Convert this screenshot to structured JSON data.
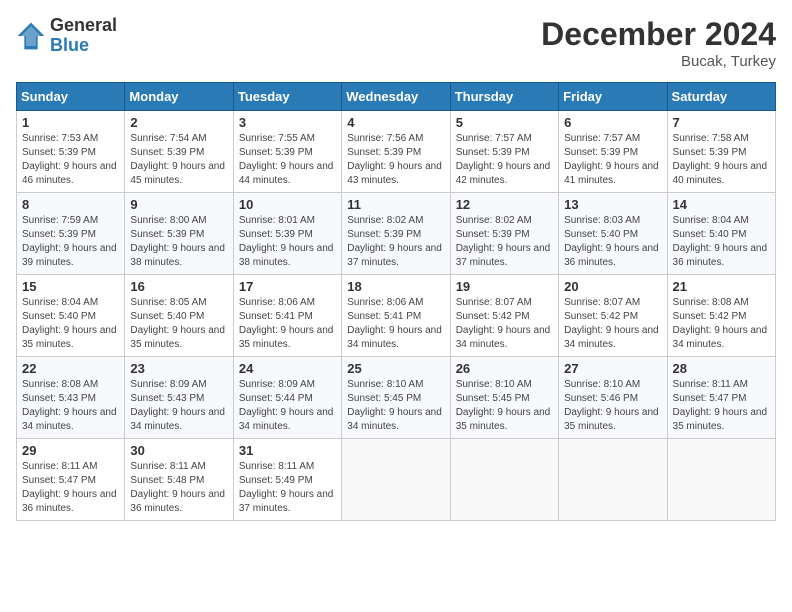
{
  "header": {
    "logo_general": "General",
    "logo_blue": "Blue",
    "month_year": "December 2024",
    "location": "Bucak, Turkey"
  },
  "columns": [
    "Sunday",
    "Monday",
    "Tuesday",
    "Wednesday",
    "Thursday",
    "Friday",
    "Saturday"
  ],
  "weeks": [
    [
      {
        "day": "1",
        "sunrise": "Sunrise: 7:53 AM",
        "sunset": "Sunset: 5:39 PM",
        "daylight": "Daylight: 9 hours and 46 minutes."
      },
      {
        "day": "2",
        "sunrise": "Sunrise: 7:54 AM",
        "sunset": "Sunset: 5:39 PM",
        "daylight": "Daylight: 9 hours and 45 minutes."
      },
      {
        "day": "3",
        "sunrise": "Sunrise: 7:55 AM",
        "sunset": "Sunset: 5:39 PM",
        "daylight": "Daylight: 9 hours and 44 minutes."
      },
      {
        "day": "4",
        "sunrise": "Sunrise: 7:56 AM",
        "sunset": "Sunset: 5:39 PM",
        "daylight": "Daylight: 9 hours and 43 minutes."
      },
      {
        "day": "5",
        "sunrise": "Sunrise: 7:57 AM",
        "sunset": "Sunset: 5:39 PM",
        "daylight": "Daylight: 9 hours and 42 minutes."
      },
      {
        "day": "6",
        "sunrise": "Sunrise: 7:57 AM",
        "sunset": "Sunset: 5:39 PM",
        "daylight": "Daylight: 9 hours and 41 minutes."
      },
      {
        "day": "7",
        "sunrise": "Sunrise: 7:58 AM",
        "sunset": "Sunset: 5:39 PM",
        "daylight": "Daylight: 9 hours and 40 minutes."
      }
    ],
    [
      {
        "day": "8",
        "sunrise": "Sunrise: 7:59 AM",
        "sunset": "Sunset: 5:39 PM",
        "daylight": "Daylight: 9 hours and 39 minutes."
      },
      {
        "day": "9",
        "sunrise": "Sunrise: 8:00 AM",
        "sunset": "Sunset: 5:39 PM",
        "daylight": "Daylight: 9 hours and 38 minutes."
      },
      {
        "day": "10",
        "sunrise": "Sunrise: 8:01 AM",
        "sunset": "Sunset: 5:39 PM",
        "daylight": "Daylight: 9 hours and 38 minutes."
      },
      {
        "day": "11",
        "sunrise": "Sunrise: 8:02 AM",
        "sunset": "Sunset: 5:39 PM",
        "daylight": "Daylight: 9 hours and 37 minutes."
      },
      {
        "day": "12",
        "sunrise": "Sunrise: 8:02 AM",
        "sunset": "Sunset: 5:39 PM",
        "daylight": "Daylight: 9 hours and 37 minutes."
      },
      {
        "day": "13",
        "sunrise": "Sunrise: 8:03 AM",
        "sunset": "Sunset: 5:40 PM",
        "daylight": "Daylight: 9 hours and 36 minutes."
      },
      {
        "day": "14",
        "sunrise": "Sunrise: 8:04 AM",
        "sunset": "Sunset: 5:40 PM",
        "daylight": "Daylight: 9 hours and 36 minutes."
      }
    ],
    [
      {
        "day": "15",
        "sunrise": "Sunrise: 8:04 AM",
        "sunset": "Sunset: 5:40 PM",
        "daylight": "Daylight: 9 hours and 35 minutes."
      },
      {
        "day": "16",
        "sunrise": "Sunrise: 8:05 AM",
        "sunset": "Sunset: 5:40 PM",
        "daylight": "Daylight: 9 hours and 35 minutes."
      },
      {
        "day": "17",
        "sunrise": "Sunrise: 8:06 AM",
        "sunset": "Sunset: 5:41 PM",
        "daylight": "Daylight: 9 hours and 35 minutes."
      },
      {
        "day": "18",
        "sunrise": "Sunrise: 8:06 AM",
        "sunset": "Sunset: 5:41 PM",
        "daylight": "Daylight: 9 hours and 34 minutes."
      },
      {
        "day": "19",
        "sunrise": "Sunrise: 8:07 AM",
        "sunset": "Sunset: 5:42 PM",
        "daylight": "Daylight: 9 hours and 34 minutes."
      },
      {
        "day": "20",
        "sunrise": "Sunrise: 8:07 AM",
        "sunset": "Sunset: 5:42 PM",
        "daylight": "Daylight: 9 hours and 34 minutes."
      },
      {
        "day": "21",
        "sunrise": "Sunrise: 8:08 AM",
        "sunset": "Sunset: 5:42 PM",
        "daylight": "Daylight: 9 hours and 34 minutes."
      }
    ],
    [
      {
        "day": "22",
        "sunrise": "Sunrise: 8:08 AM",
        "sunset": "Sunset: 5:43 PM",
        "daylight": "Daylight: 9 hours and 34 minutes."
      },
      {
        "day": "23",
        "sunrise": "Sunrise: 8:09 AM",
        "sunset": "Sunset: 5:43 PM",
        "daylight": "Daylight: 9 hours and 34 minutes."
      },
      {
        "day": "24",
        "sunrise": "Sunrise: 8:09 AM",
        "sunset": "Sunset: 5:44 PM",
        "daylight": "Daylight: 9 hours and 34 minutes."
      },
      {
        "day": "25",
        "sunrise": "Sunrise: 8:10 AM",
        "sunset": "Sunset: 5:45 PM",
        "daylight": "Daylight: 9 hours and 34 minutes."
      },
      {
        "day": "26",
        "sunrise": "Sunrise: 8:10 AM",
        "sunset": "Sunset: 5:45 PM",
        "daylight": "Daylight: 9 hours and 35 minutes."
      },
      {
        "day": "27",
        "sunrise": "Sunrise: 8:10 AM",
        "sunset": "Sunset: 5:46 PM",
        "daylight": "Daylight: 9 hours and 35 minutes."
      },
      {
        "day": "28",
        "sunrise": "Sunrise: 8:11 AM",
        "sunset": "Sunset: 5:47 PM",
        "daylight": "Daylight: 9 hours and 35 minutes."
      }
    ],
    [
      {
        "day": "29",
        "sunrise": "Sunrise: 8:11 AM",
        "sunset": "Sunset: 5:47 PM",
        "daylight": "Daylight: 9 hours and 36 minutes."
      },
      {
        "day": "30",
        "sunrise": "Sunrise: 8:11 AM",
        "sunset": "Sunset: 5:48 PM",
        "daylight": "Daylight: 9 hours and 36 minutes."
      },
      {
        "day": "31",
        "sunrise": "Sunrise: 8:11 AM",
        "sunset": "Sunset: 5:49 PM",
        "daylight": "Daylight: 9 hours and 37 minutes."
      },
      null,
      null,
      null,
      null
    ]
  ]
}
